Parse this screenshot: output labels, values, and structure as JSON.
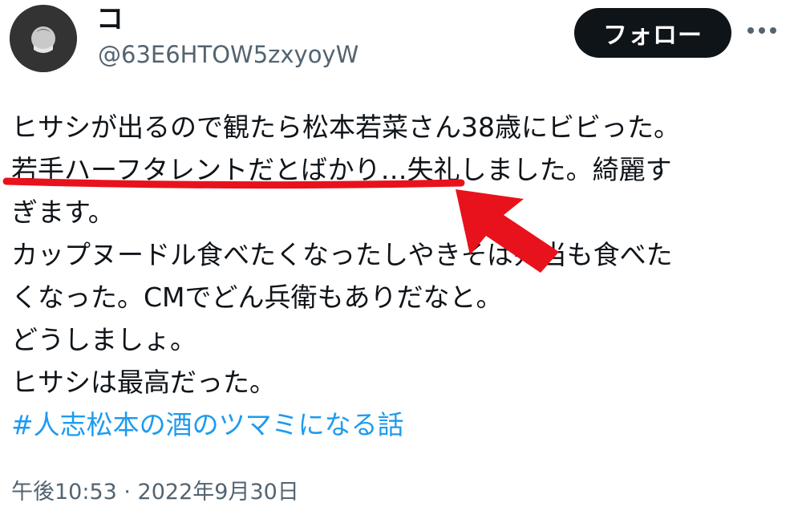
{
  "author": {
    "display_name": "コ",
    "handle": "@63E6HTOW5zxyoyW",
    "avatar_icon": "avatar-icon"
  },
  "actions": {
    "follow_label": "フォロー",
    "more_icon": "more-icon"
  },
  "tweet": {
    "lines": [
      "ヒサシが出るので観たら松本若菜さん38歳にビビった。",
      "若手ハーフタレントだとばかり…失礼しました。綺麗す",
      "ぎます。",
      "カップヌードル食べたくなったしやきそば弁当も食べた",
      "くなった。CMでどん兵衛もありだなと。",
      "どうしましょ。",
      "ヒサシは最高だった。"
    ],
    "hashtag": "#人志松本の酒のツマミになる話"
  },
  "timestamp": "午後10:53 · 2022年9月30日",
  "colors": {
    "text": "#0f1419",
    "secondary": "#536471",
    "link": "#1d9bf0",
    "annotation": "#e8121c"
  }
}
